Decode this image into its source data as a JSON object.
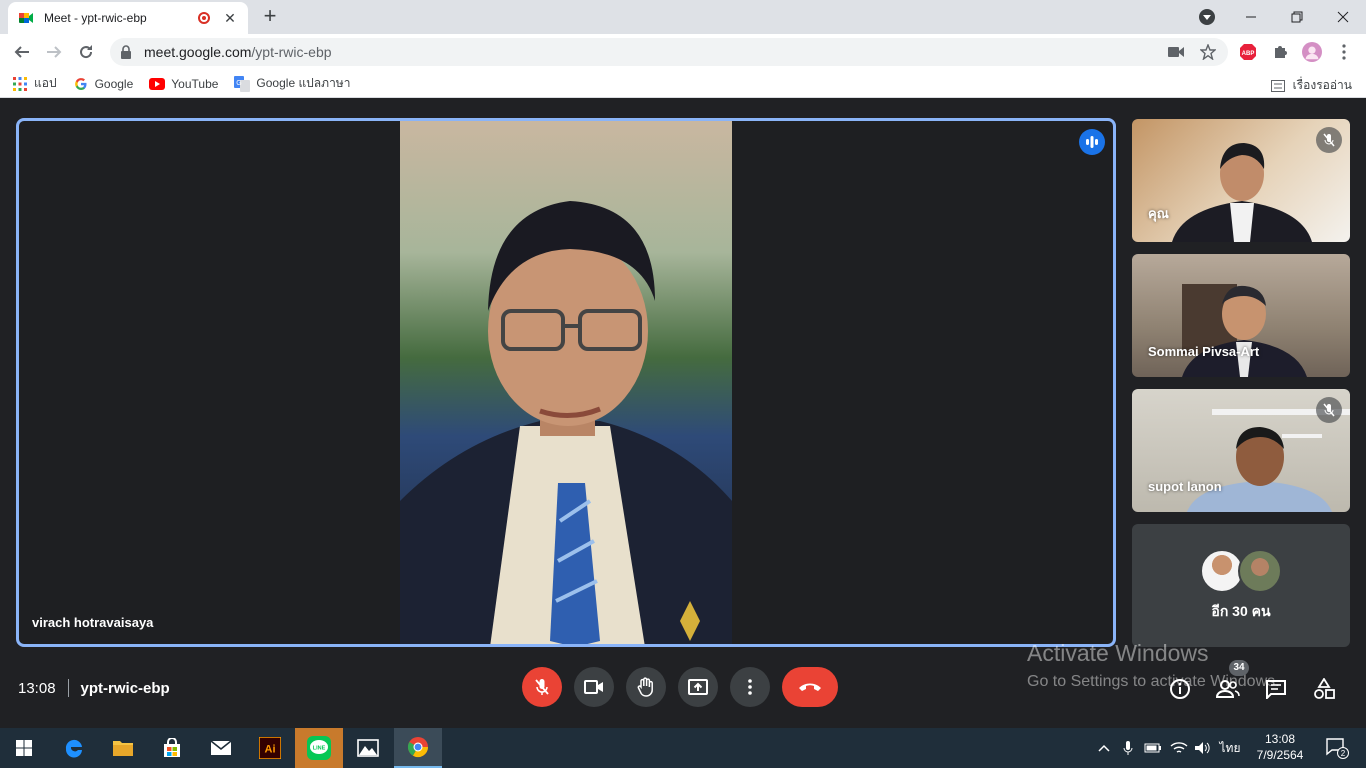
{
  "browser": {
    "tab_title": "Meet - ypt-rwic-ebp",
    "url_host": "meet.google.com",
    "url_path": "/ypt-rwic-ebp",
    "bookmarks": [
      {
        "label": "แอป",
        "icon": "apps-grid-icon"
      },
      {
        "label": "Google",
        "icon": "google-icon"
      },
      {
        "label": "YouTube",
        "icon": "youtube-icon"
      },
      {
        "label": "Google แปลภาษา",
        "icon": "google-translate-icon"
      }
    ],
    "reading_list": "เรื่องรออ่าน",
    "extension_badge": "ABP"
  },
  "meet": {
    "main_speaker": "virach hotravaisaya",
    "participants": [
      {
        "name": "คุณ",
        "muted": true
      },
      {
        "name": "Sommai Pivsa-Art",
        "muted": false
      },
      {
        "name": "supot lanon",
        "muted": true
      }
    ],
    "more_participants": "อีก 30 คน",
    "time": "13:08",
    "meeting_code": "ypt-rwic-ebp",
    "participant_count": "34"
  },
  "watermark": {
    "line1": "Activate Windows",
    "line2": "Go to Settings to activate Windows."
  },
  "taskbar": {
    "clock_time": "13:08",
    "clock_date": "7/9/2564",
    "language": "ไทย",
    "notifications": "2",
    "illustrator_label": "Ai",
    "line_label": "LINE"
  },
  "colors": {
    "meet_bg": "#202124",
    "active_speaker_border": "#8ab4f8",
    "end_call": "#ea4335",
    "taskbar_bg": "#1f2e3a"
  }
}
